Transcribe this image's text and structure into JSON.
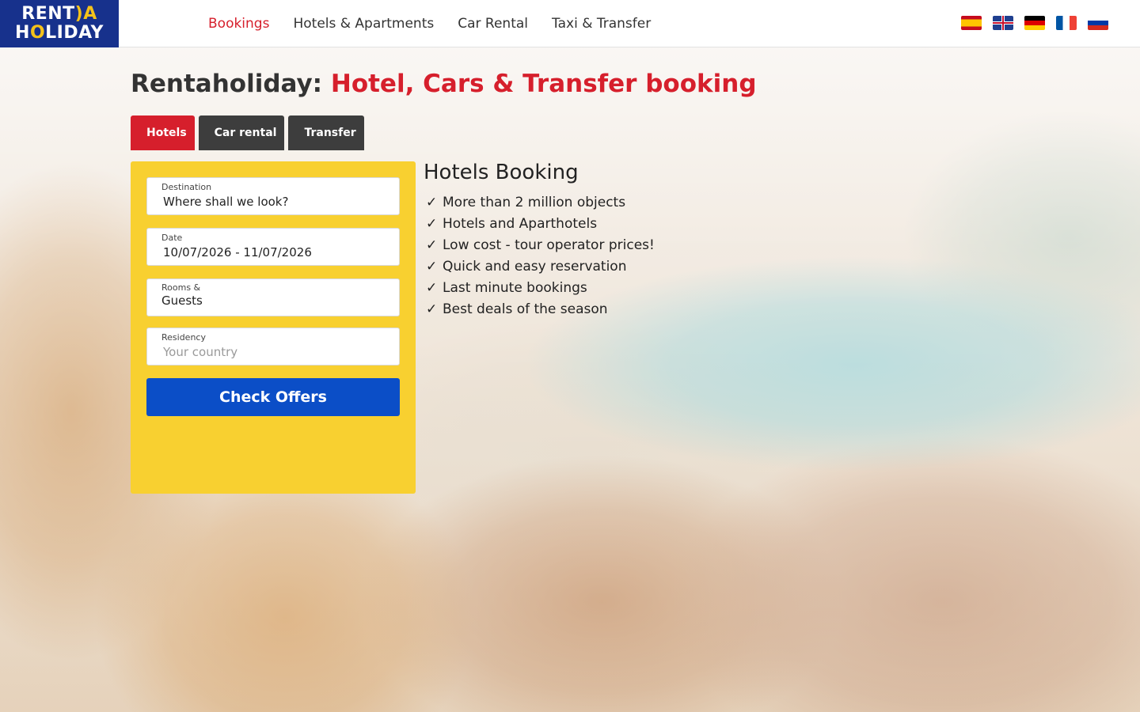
{
  "logo": {
    "line1_a": "RENT",
    "line1_b": ")A",
    "line2_a": "H",
    "line2_b": "O",
    "line2_c": "LIDAY"
  },
  "nav": {
    "items": [
      {
        "icon": "calendar-icon",
        "glyph": "",
        "label": "Bookings"
      },
      {
        "icon": "hotel-icon",
        "glyph": "",
        "label": "Hotels & Apartments"
      },
      {
        "icon": "car-icon",
        "glyph": "",
        "label": "Car Rental"
      },
      {
        "icon": "taxi-icon",
        "glyph": "",
        "label": "Taxi & Transfer"
      }
    ]
  },
  "languages": [
    "es",
    "en",
    "de",
    "fr",
    "ru"
  ],
  "page": {
    "title_prefix": "Rentaholiday: ",
    "title_highlight": "Hotel, Cars & Transfer booking"
  },
  "tabs": [
    {
      "label": "Hotels",
      "glyph": "",
      "icon": "bed-icon"
    },
    {
      "label": "Car rental",
      "glyph": "",
      "icon": "car-icon"
    },
    {
      "label": "Transfer",
      "glyph": "",
      "icon": "bus-icon"
    }
  ],
  "form": {
    "destination": {
      "label": "Destination",
      "value": "Where shall we look?"
    },
    "date": {
      "label": "Date",
      "value": "10/07/2026 - 11/07/2026"
    },
    "rooms": {
      "label": "Rooms &",
      "value": "Guests"
    },
    "residency": {
      "label": "Residency",
      "placeholder": "Your country"
    },
    "submit_label": "Check Offers"
  },
  "info": {
    "heading": "Hotels Booking",
    "check": "✓",
    "items": [
      "More than 2 million objects",
      "Hotels and Aparthotels",
      "Low cost - tour operator prices!",
      "Quick and easy reservation",
      "Last minute bookings",
      "Best deals of the season"
    ]
  },
  "colors": {
    "brand_blue": "#17318c",
    "accent_red": "#d61f2c",
    "panel_yellow": "#f8d030",
    "button_blue": "#0b4ec7",
    "tab_dark": "#3d3d3d"
  }
}
